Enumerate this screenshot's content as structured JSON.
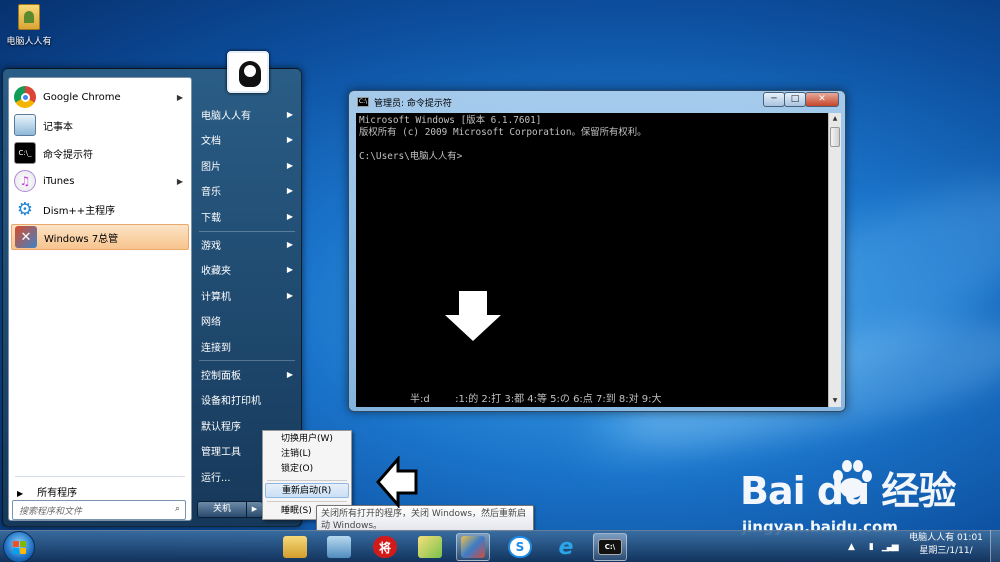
{
  "desktop": {
    "icon_label": "电脑人人有"
  },
  "start_menu": {
    "programs": [
      {
        "label": "Google Chrome",
        "has_arrow": true,
        "icon": "chrome-icon"
      },
      {
        "label": "记事本",
        "has_arrow": false,
        "icon": "notepad-icon"
      },
      {
        "label": "命令提示符",
        "has_arrow": false,
        "icon": "cmd-icon"
      },
      {
        "label": "iTunes",
        "has_arrow": true,
        "icon": "itunes-icon"
      },
      {
        "label": "Dism++主程序",
        "has_arrow": false,
        "icon": "gear-icon"
      },
      {
        "label": "Windows 7总管",
        "has_arrow": false,
        "icon": "tools-icon",
        "highlighted": true
      }
    ],
    "all_programs": "所有程序",
    "search_placeholder": "搜索程序和文件",
    "right_links": [
      {
        "label": "电脑人人有",
        "has_arrow": true
      },
      {
        "label": "文档",
        "has_arrow": true
      },
      {
        "label": "图片",
        "has_arrow": true
      },
      {
        "label": "音乐",
        "has_arrow": true
      },
      {
        "label": "下载",
        "has_arrow": true
      },
      {
        "label": "游戏",
        "has_arrow": true
      },
      {
        "label": "收藏夹",
        "has_arrow": true
      },
      {
        "label": "计算机",
        "has_arrow": true
      },
      {
        "label": "网络",
        "has_arrow": false
      },
      {
        "label": "连接到",
        "has_arrow": false
      },
      {
        "label": "控制面板",
        "has_arrow": true
      },
      {
        "label": "设备和打印机",
        "has_arrow": false
      },
      {
        "label": "默认程序",
        "has_arrow": false
      },
      {
        "label": "管理工具",
        "has_arrow": true
      },
      {
        "label": "运行...",
        "has_arrow": false
      }
    ],
    "shutdown_label": "关机",
    "shutdown_arrow": "▶"
  },
  "shutdown_menu": {
    "items": [
      "切换用户(W)",
      "注销(L)",
      "锁定(O)",
      "重新启动(R)",
      "睡眠(S)"
    ],
    "highlighted_index": 3,
    "tooltip": "关闭所有打开的程序，关闭 Windows，然后重新启动 Windows。"
  },
  "cmd_window": {
    "title": "管理员: 命令提示符",
    "title_icon": "C:\\",
    "minimize": "─",
    "maximize": "□",
    "close": "✕",
    "lines": [
      "Microsoft Windows [版本 6.1.7601]",
      "版权所有 (c) 2009 Microsoft Corporation。保留所有权利。",
      "",
      "C:\\Users\\电脑人人有>"
    ],
    "ime_bar": "半:d        :1:的 2:打 3:都 4:等 5:の 6:点 7:到 8:对 9:大"
  },
  "watermark": {
    "brand": "Bai du 经验",
    "url": "jingyan.baidu.com"
  },
  "taskbar": {
    "apps": [
      {
        "name": "explorer-icon",
        "glyph": "",
        "color": "#e7b94a"
      },
      {
        "name": "network-app-icon",
        "glyph": "",
        "color": "#5b9a38"
      },
      {
        "name": "chinese-chess-icon",
        "glyph": "将",
        "color": "#d11b1b"
      },
      {
        "name": "folder-app-icon",
        "glyph": "",
        "color": "#7bc14c"
      },
      {
        "name": "paint-icon",
        "glyph": "",
        "color": "#3b7cc9"
      },
      {
        "name": "sogou-icon",
        "glyph": "S",
        "color": "#1d8ae6"
      },
      {
        "name": "ie-icon",
        "glyph": "e",
        "color": "#2aa6e8"
      },
      {
        "name": "cmd-icon",
        "glyph": "C:\\",
        "color": "#111111"
      }
    ],
    "active_app": 7,
    "clock_line1": "电脑人人有 01:01",
    "clock_line2": "星期三/1/11/"
  }
}
